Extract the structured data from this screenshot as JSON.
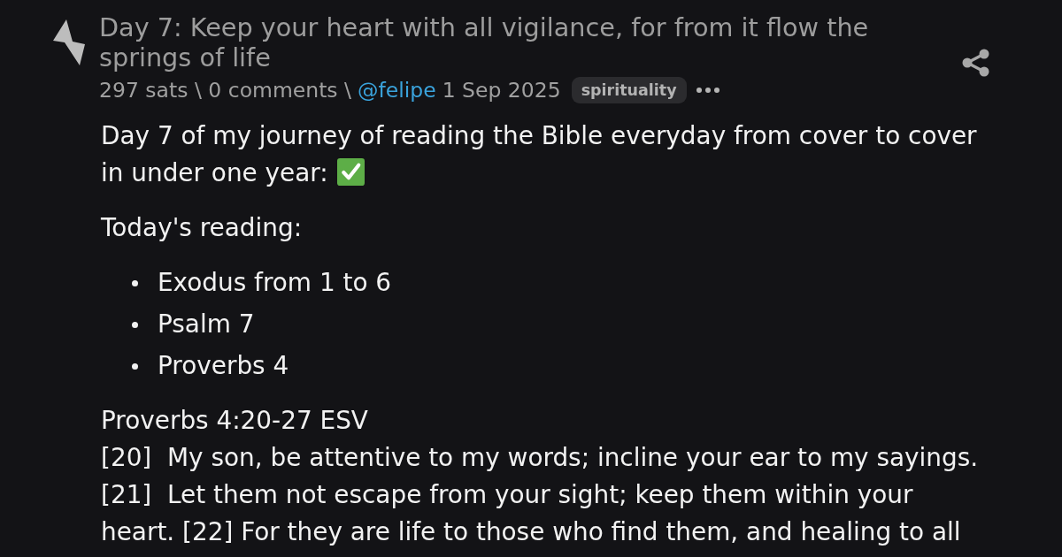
{
  "post": {
    "title": "Day 7: Keep your heart with all vigilance, for from it flow the springs of life",
    "stats": "297 sats \\ 0 comments \\",
    "author": "@felipe",
    "date": "1 Sep 2025",
    "tag": "spirituality",
    "body": [
      {
        "kind": "paragraph",
        "text": "Day 7 of my journey of reading the Bible everyday from cover to cover in under one year:",
        "check_mark": true
      },
      {
        "kind": "paragraph",
        "text": "Today's reading:",
        "check_mark": false
      },
      {
        "kind": "list",
        "items": [
          "Exodus from 1 to 6",
          "Psalm 7",
          "Proverbs 4"
        ]
      },
      {
        "kind": "lines",
        "lines": [
          "Proverbs 4:20-27 ESV",
          "[20]  My son, be attentive to my words; incline your ear to my sayings.",
          "[21]  Let them not escape from your sight; keep them within your heart. [22] For they are life to those who find them, and healing to all"
        ]
      }
    ]
  }
}
